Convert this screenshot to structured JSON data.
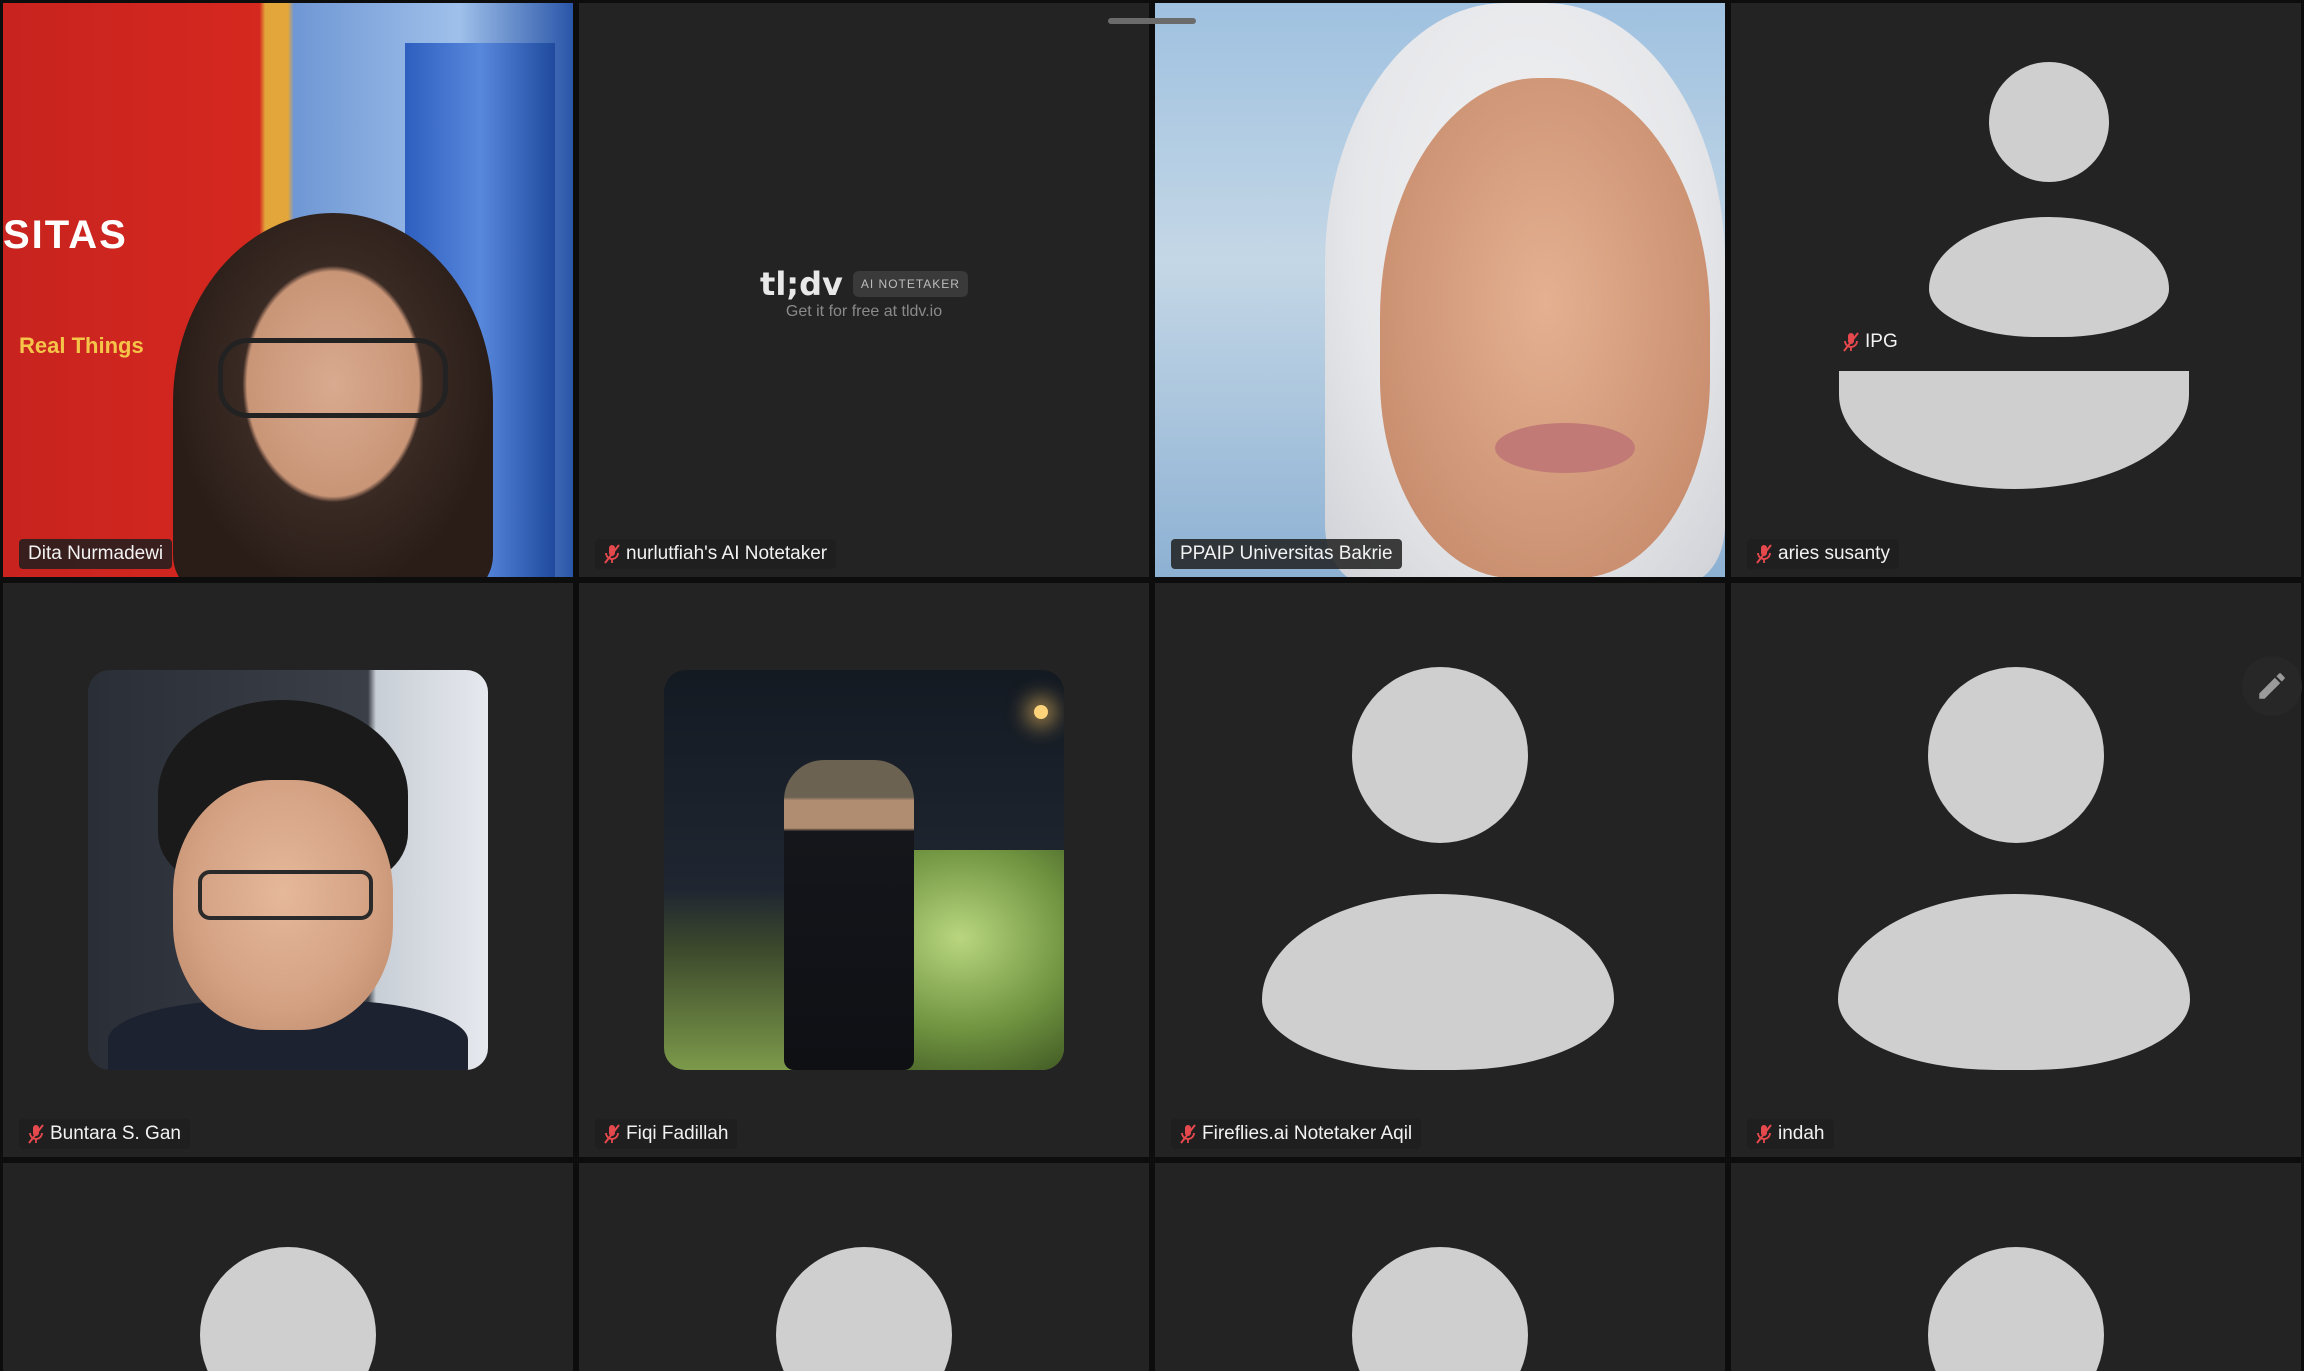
{
  "tiles": [
    {
      "name": "Dita Nurmadewi",
      "muted": false,
      "kind": "video",
      "active": false,
      "video_text": {
        "banner_word": "SITAS",
        "tagline": "Real Things"
      }
    },
    {
      "name": "nurlutfiah's AI Notetaker",
      "muted": true,
      "kind": "app",
      "app_brand": "tl;dv",
      "app_badge": "AI NOTETAKER",
      "app_sub": "Get it for free at tldv.io"
    },
    {
      "name": "PPAIP Universitas Bakrie",
      "muted": false,
      "kind": "video",
      "active": true
    },
    {
      "name": "aries susanty",
      "muted": true,
      "kind": "placeholder"
    },
    {
      "name": "Buntara S. Gan",
      "muted": true,
      "kind": "photo"
    },
    {
      "name": "Fiqi Fadillah",
      "muted": true,
      "kind": "photo"
    },
    {
      "name": "Fireflies.ai Notetaker Aqil",
      "muted": true,
      "kind": "placeholder"
    },
    {
      "name": "indah",
      "muted": true,
      "kind": "placeholder"
    },
    {
      "name": "",
      "muted": false,
      "kind": "placeholder"
    },
    {
      "name": "",
      "muted": false,
      "kind": "placeholder"
    },
    {
      "name": "",
      "muted": false,
      "kind": "placeholder"
    },
    {
      "name": "",
      "muted": false,
      "kind": "placeholder"
    }
  ],
  "floating_tag": {
    "name": "IPG",
    "muted": true
  },
  "colors": {
    "active_border": "#3ecf6e",
    "mic_off": "#e5484d",
    "placeholder": "#cfcfcf",
    "tile_bg": "#232323"
  },
  "icons": {
    "mic_off": "mic-off-icon",
    "edit": "pencil-icon"
  }
}
